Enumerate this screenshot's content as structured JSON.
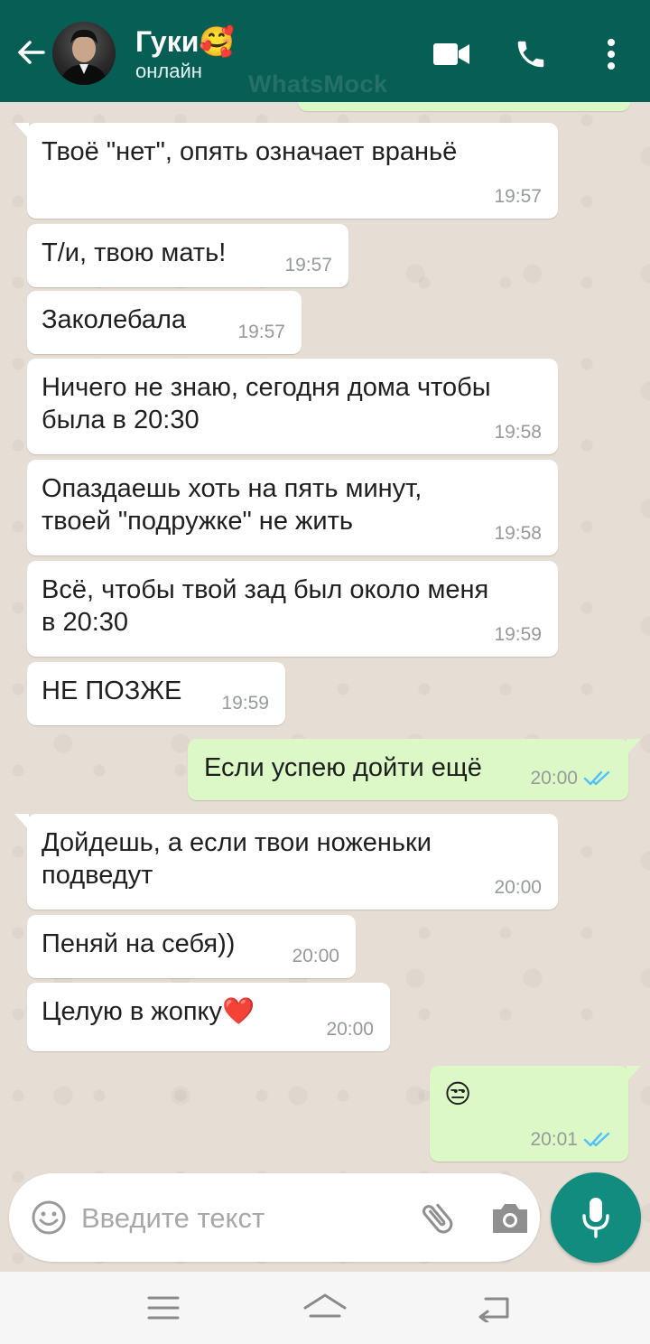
{
  "header": {
    "contact_name": "Гуки🥰",
    "status": "онлайн",
    "watermark": "WhatsMock",
    "colors": {
      "bar": "#075e54",
      "icons": "#ffffff"
    }
  },
  "messages": [
    {
      "dir": "in",
      "text": "Твоё \"нет\", опять означает враньё",
      "time": "19:57"
    },
    {
      "dir": "in",
      "text": "Т/и, твою мать!",
      "time": "19:57"
    },
    {
      "dir": "in",
      "text": "Заколебала",
      "time": "19:57"
    },
    {
      "dir": "in",
      "text": "Ничего не знаю, сегодня дома чтобы\nбыла в 20:30",
      "time": "19:58"
    },
    {
      "dir": "in",
      "text": "Опаздаешь хоть на пять минут,\nтвоей \"подружке\" не жить",
      "time": "19:58"
    },
    {
      "dir": "in",
      "text": "Всё, чтобы твой зад был около меня\nв 20:30",
      "time": "19:59"
    },
    {
      "dir": "in",
      "text": "НЕ ПОЗЖЕ",
      "time": "19:59"
    },
    {
      "dir": "out",
      "text": "Если успею дойти ещё",
      "time": "20:00",
      "status": "read"
    },
    {
      "dir": "in",
      "text": "Дойдешь, а если твои ноженьки\nподведут",
      "time": "20:00"
    },
    {
      "dir": "in",
      "text": "Пеняй на себя))",
      "time": "20:00"
    },
    {
      "dir": "in",
      "text": "Целую в жопку❤️",
      "time": "20:00"
    },
    {
      "dir": "out",
      "text": "😒",
      "time": "20:01",
      "status": "read"
    }
  ],
  "input": {
    "placeholder": "Введите текст"
  },
  "icons": {
    "back": "arrow-left-icon",
    "video": "video-camera-icon",
    "call": "phone-icon",
    "more": "more-vertical-icon",
    "emoji": "emoji-icon",
    "attach": "paperclip-icon",
    "camera": "camera-icon",
    "mic": "microphone-icon",
    "check": "double-check-icon"
  },
  "colors": {
    "incoming": "#ffffff",
    "outgoing": "#dcf8c6",
    "read_check": "#4fc3f7",
    "mic_button": "#128c7e"
  }
}
